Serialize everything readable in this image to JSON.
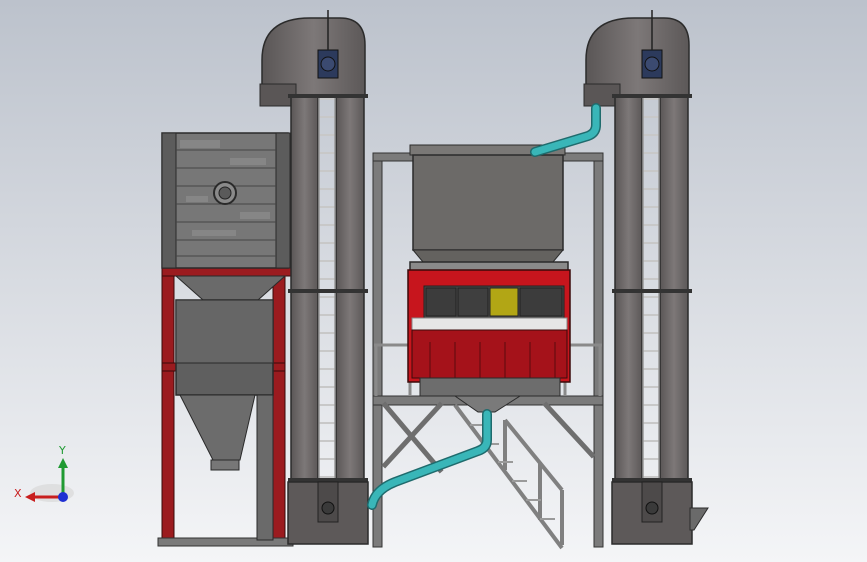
{
  "scene": {
    "background_top": "#bcc2cc",
    "background_bottom": "#f4f5f7"
  },
  "triad": {
    "x_label": "X",
    "y_label": "Y",
    "x_color": "#c81e1e",
    "y_color": "#1f9a32",
    "z_color": "#1e2fd2"
  },
  "colors": {
    "elevator_body": "#6f6b6b",
    "elevator_edge": "#2b2b2b",
    "frame_red": "#9b1b1f",
    "frame_steel": "#7b7b7b",
    "pipe_cyan": "#39b6b8",
    "hopper_gray": "#6c6a68",
    "sorter_red": "#c7151d",
    "sorter_yellow": "#b2a615",
    "motor_blue": "#2c3a5c"
  }
}
